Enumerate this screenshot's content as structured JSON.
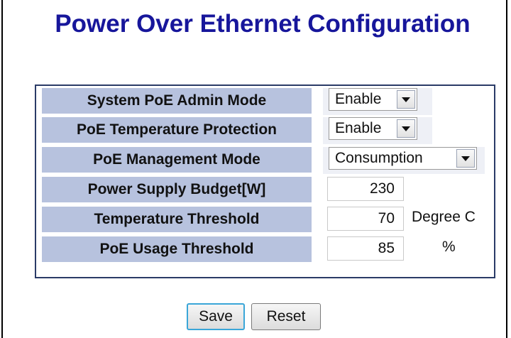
{
  "title": "Power Over Ethernet Configuration",
  "rows": [
    {
      "label": "System PoE Admin Mode",
      "value": "Enable"
    },
    {
      "label": "PoE Temperature Protection",
      "value": "Enable"
    },
    {
      "label": "PoE Management Mode",
      "value": "Consumption"
    },
    {
      "label": "Power Supply Budget[W]",
      "value": "230"
    },
    {
      "label": "Temperature Threshold",
      "value": "70",
      "unit": "Degree C"
    },
    {
      "label": "PoE Usage Threshold",
      "value": "85",
      "unit": "%"
    }
  ],
  "buttons": {
    "save": "Save",
    "reset": "Reset"
  },
  "colors": {
    "title": "#17169b",
    "label_bg": "#b7c2de",
    "border": "#2a3b67"
  }
}
